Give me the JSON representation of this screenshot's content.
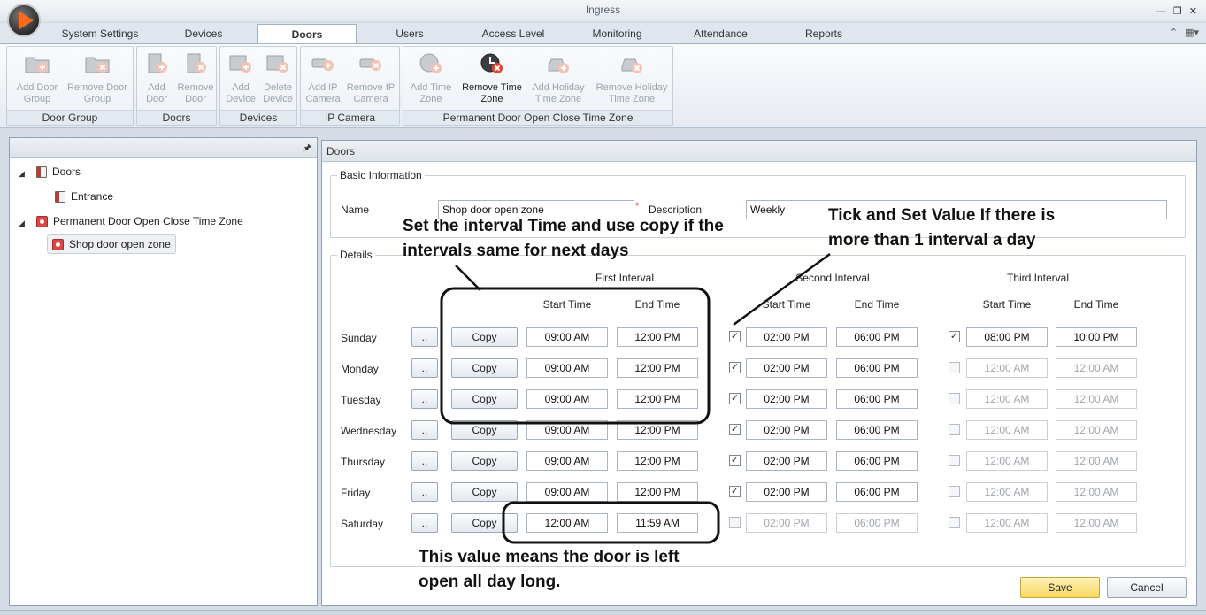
{
  "window": {
    "title": "Ingress"
  },
  "tabs": [
    "System Settings",
    "Devices",
    "Doors",
    "Users",
    "Access Level",
    "Monitoring",
    "Attendance",
    "Reports"
  ],
  "active_tab": "Doors",
  "ribbon": {
    "groups": {
      "door_group": {
        "label": "Door Group",
        "add": "Add Door Group",
        "remove": "Remove Door Group"
      },
      "doors": {
        "label": "Doors",
        "add": "Add Door",
        "remove": "Remove Door"
      },
      "devices": {
        "label": "Devices",
        "add": "Add Device",
        "delete": "Delete Device"
      },
      "ip_camera": {
        "label": "IP Camera",
        "add": "Add IP Camera",
        "remove": "Remove IP Camera"
      },
      "time_zone": {
        "label": "Permanent Door Open Close Time Zone",
        "add_tz": "Add Time Zone",
        "remove_tz": "Remove Time Zone",
        "add_holiday": "Add Holiday Time Zone",
        "remove_holiday": "Remove Holiday Time Zone"
      }
    }
  },
  "tree": {
    "doors": "Doors",
    "entrance": "Entrance",
    "tz_root": "Permanent Door Open Close Time Zone",
    "tz_item": "Shop door open zone"
  },
  "panel": {
    "title": "Doors",
    "basic_info": "Basic Information",
    "name_label": "Name",
    "name_value": "Shop door open zone",
    "required_mark": "*",
    "desc_label": "Description",
    "desc_value": "Weekly",
    "details": "Details",
    "first_interval": "First Interval",
    "second_interval": "Second Interval",
    "third_interval": "Third Interval",
    "start_time": "Start Time",
    "end_time": "End Time",
    "copy_label": "Copy",
    "dots_label": "..",
    "save": "Save",
    "cancel": "Cancel"
  },
  "schedule": [
    {
      "day": "Sunday",
      "i1": [
        "09:00 AM",
        "12:00 PM"
      ],
      "c2": true,
      "i2": [
        "02:00 PM",
        "06:00 PM"
      ],
      "c3": true,
      "i3": [
        "08:00 PM",
        "10:00 PM"
      ]
    },
    {
      "day": "Monday",
      "i1": [
        "09:00 AM",
        "12:00 PM"
      ],
      "c2": true,
      "i2": [
        "02:00 PM",
        "06:00 PM"
      ],
      "c3": false,
      "i3": [
        "12:00 AM",
        "12:00 AM"
      ]
    },
    {
      "day": "Tuesday",
      "i1": [
        "09:00 AM",
        "12:00 PM"
      ],
      "c2": true,
      "i2": [
        "02:00 PM",
        "06:00 PM"
      ],
      "c3": false,
      "i3": [
        "12:00 AM",
        "12:00 AM"
      ]
    },
    {
      "day": "Wednesday",
      "i1": [
        "09:00 AM",
        "12:00 PM"
      ],
      "c2": true,
      "i2": [
        "02:00 PM",
        "06:00 PM"
      ],
      "c3": false,
      "i3": [
        "12:00 AM",
        "12:00 AM"
      ]
    },
    {
      "day": "Thursday",
      "i1": [
        "09:00 AM",
        "12:00 PM"
      ],
      "c2": true,
      "i2": [
        "02:00 PM",
        "06:00 PM"
      ],
      "c3": false,
      "i3": [
        "12:00 AM",
        "12:00 AM"
      ]
    },
    {
      "day": "Friday",
      "i1": [
        "09:00 AM",
        "12:00 PM"
      ],
      "c2": true,
      "i2": [
        "02:00 PM",
        "06:00 PM"
      ],
      "c3": false,
      "i3": [
        "12:00 AM",
        "12:00 AM"
      ]
    },
    {
      "day": "Saturday",
      "i1": [
        "12:00 AM",
        "11:59 AM"
      ],
      "c2": false,
      "i2": [
        "02:00 PM",
        "06:00 PM"
      ],
      "c3": false,
      "i3": [
        "12:00 AM",
        "12:00 AM"
      ]
    }
  ],
  "annotations": {
    "copy_note_1": "Set the interval Time and use copy if the",
    "copy_note_2": "intervals same for next days",
    "tick_note_1": "Tick and Set Value If there is",
    "tick_note_2": "more than 1 interval a day",
    "allday_note_1": "This value means the door is left",
    "allday_note_2": "open all day long."
  }
}
